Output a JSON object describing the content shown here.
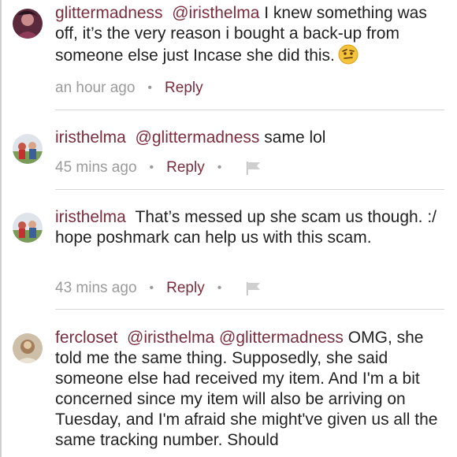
{
  "comments": [
    {
      "username": "glittermadness",
      "mentions": "@iristhelma",
      "text": "I knew something was off, it’s the very reason i bought a back-up from someone else just Incase she did this.",
      "emoji": "raised-eyebrow-face",
      "time": "an hour ago",
      "reply_label": "Reply"
    },
    {
      "username": "iristhelma",
      "mentions": "@glittermadness",
      "text": "same lol",
      "time": "45 mins ago",
      "reply_label": "Reply"
    },
    {
      "username": "iristhelma",
      "mentions": "",
      "text": "That’s messed up she scam us though. :/ hope poshmark can help us with this scam.",
      "time": "43 mins ago",
      "reply_label": "Reply"
    },
    {
      "username": "fercloset",
      "mentions": "@iristhelma @glittermadness",
      "text": "OMG, she told me the same thing. Supposedly, she said someone else had received my item. And I'm a bit concerned since my item will also be arriving on Tuesday, and I'm afraid she might've given us all the same tracking number. Should"
    }
  ],
  "colors": {
    "username": "#7b2d3e",
    "meta": "#9b9b9b",
    "text": "#222222"
  }
}
